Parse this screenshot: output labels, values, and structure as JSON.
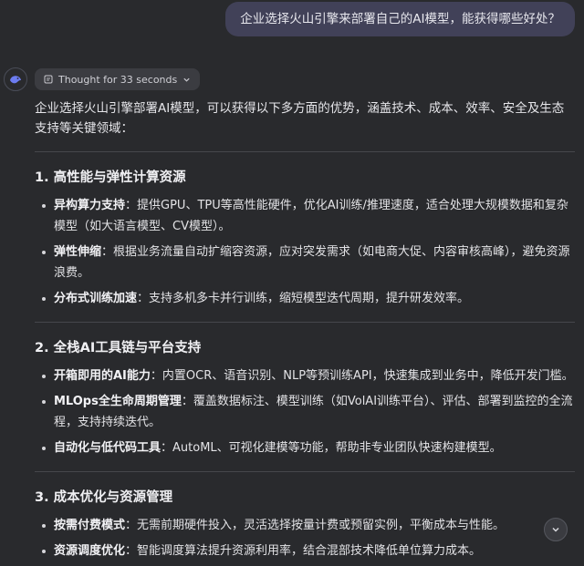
{
  "user_message": "企业选择火山引擎来部署自己的AI模型，能获得哪些好处？",
  "assistant": {
    "avatar_icon": "whale-logo-icon",
    "thought_label": "Thought for 33 seconds",
    "intro": "企业选择火山引擎部署AI模型，可以获得以下多方面的优势，涵盖技术、成本、效率、安全及生态支持等关键领域：",
    "sections": [
      {
        "title": "1. 高性能与弹性计算资源",
        "items": [
          {
            "bold": "异构算力支持",
            "text": "：提供GPU、TPU等高性能硬件，优化AI训练/推理速度，适合处理大规模数据和复杂模型（如大语言模型、CV模型）。"
          },
          {
            "bold": "弹性伸缩",
            "text": "：根据业务流量自动扩缩容资源，应对突发需求（如电商大促、内容审核高峰），避免资源浪费。"
          },
          {
            "bold": "分布式训练加速",
            "text": "：支持多机多卡并行训练，缩短模型迭代周期，提升研发效率。"
          }
        ]
      },
      {
        "title": "2. 全栈AI工具链与平台支持",
        "items": [
          {
            "bold": "开箱即用的AI能力",
            "text": "：内置OCR、语音识别、NLP等预训练API，快速集成到业务中，降低开发门槛。"
          },
          {
            "bold": "MLOps全生命周期管理",
            "text": "：覆盖数据标注、模型训练（如VolAI训练平台）、评估、部署到监控的全流程，支持持续迭代。"
          },
          {
            "bold": "自动化与低代码工具",
            "text": "：AutoML、可视化建模等功能，帮助非专业团队快速构建模型。"
          }
        ]
      },
      {
        "title": "3. 成本优化与资源管理",
        "items": [
          {
            "bold": "按需付费模式",
            "text": "：无需前期硬件投入，灵活选择按量计费或预留实例，平衡成本与性能。"
          },
          {
            "bold": "资源调度优化",
            "text": "：智能调度算法提升资源利用率，结合混部技术降低单位算力成本。"
          }
        ]
      }
    ]
  },
  "scroll_button_icon": "chevron-down-icon"
}
